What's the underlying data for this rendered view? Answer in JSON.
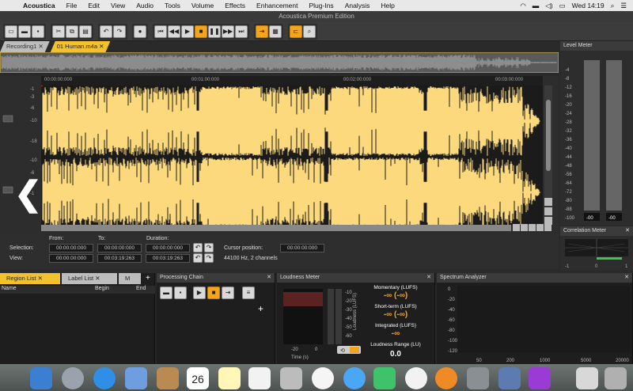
{
  "menubar": {
    "app": "Acoustica",
    "items": [
      "File",
      "Edit",
      "View",
      "Audio",
      "Tools",
      "Volume",
      "Effects",
      "Enhancement",
      "Plug-Ins",
      "Analysis",
      "Help"
    ],
    "clock": "Wed 14:19"
  },
  "window_title": "Acoustica Premium Edition",
  "tabs": [
    "Recording1",
    "01 Human.m4a"
  ],
  "ruler": [
    "00:00:00:000",
    "00:01:00:000",
    "00:02:00:000",
    "00:03:00:000"
  ],
  "yticks": [
    "-1",
    "-3",
    "-6",
    "-10",
    "-18",
    "-10",
    "-6",
    "-3",
    "-1"
  ],
  "selection": {
    "from_label": "From:",
    "to_label": "To:",
    "duration_label": "Duration:",
    "selection_label": "Selection:",
    "view_label": "View:",
    "sel_from": "00:00:00:000",
    "sel_to": "00:00:00:000",
    "sel_dur": "00:00:00:000",
    "view_from": "00:00:00:000",
    "view_to": "00:03:19:263",
    "view_dur": "00:03:19:263",
    "cursor_label": "Cursor position:",
    "cursor_value": "00:00:00:000",
    "format": "44100 Hz, 2 channels"
  },
  "level_meter": {
    "title": "Level Meter",
    "ticks": [
      "-4",
      "-8",
      "-12",
      "-16",
      "-20",
      "-24",
      "-28",
      "-32",
      "-36",
      "-40",
      "-44",
      "-48",
      "-56",
      "-64",
      "-72",
      "-80",
      "-88",
      "-100"
    ],
    "left_value": "-00",
    "right_value": "-00"
  },
  "correlation": {
    "title": "Correlation Meter",
    "ticks": [
      "-1",
      "0",
      "1"
    ]
  },
  "bottom": {
    "region_tab": "Region List",
    "label_tab": "Label List",
    "more_tab": "M",
    "cols": [
      "Name",
      "Begin",
      "End"
    ],
    "processing_title": "Processing Chain",
    "loudness_title": "Loudness Meter",
    "loudness_ticks": [
      "-10",
      "-20",
      "-30",
      "-40",
      "-50",
      "-60"
    ],
    "loudness_axis": "Loudness (LUFS)",
    "loudness_x": [
      "-20",
      "0"
    ],
    "time_label": "Time (s)",
    "momentary_label": "Momentary (LUFS)",
    "momentary_value": "-∞ (-∞)",
    "shortterm_label": "Short-term (LUFS)",
    "shortterm_value": "-∞ (-∞)",
    "integrated_label": "Integrated (LUFS)",
    "integrated_value": "-∞",
    "range_label": "Loudness Range (LU)",
    "range_value": "0.0",
    "spectrum_title": "Spectrum Analyzer",
    "spectrum_y": [
      "0",
      "-20",
      "-40",
      "-60",
      "-80",
      "-100",
      "-120"
    ],
    "spectrum_x": [
      "50",
      "200",
      "1000",
      "5000",
      "20000"
    ]
  },
  "colors": {
    "accent": "#f3c12b",
    "wave": "#fbd97c",
    "wave_dark": "#1b1b1b"
  }
}
